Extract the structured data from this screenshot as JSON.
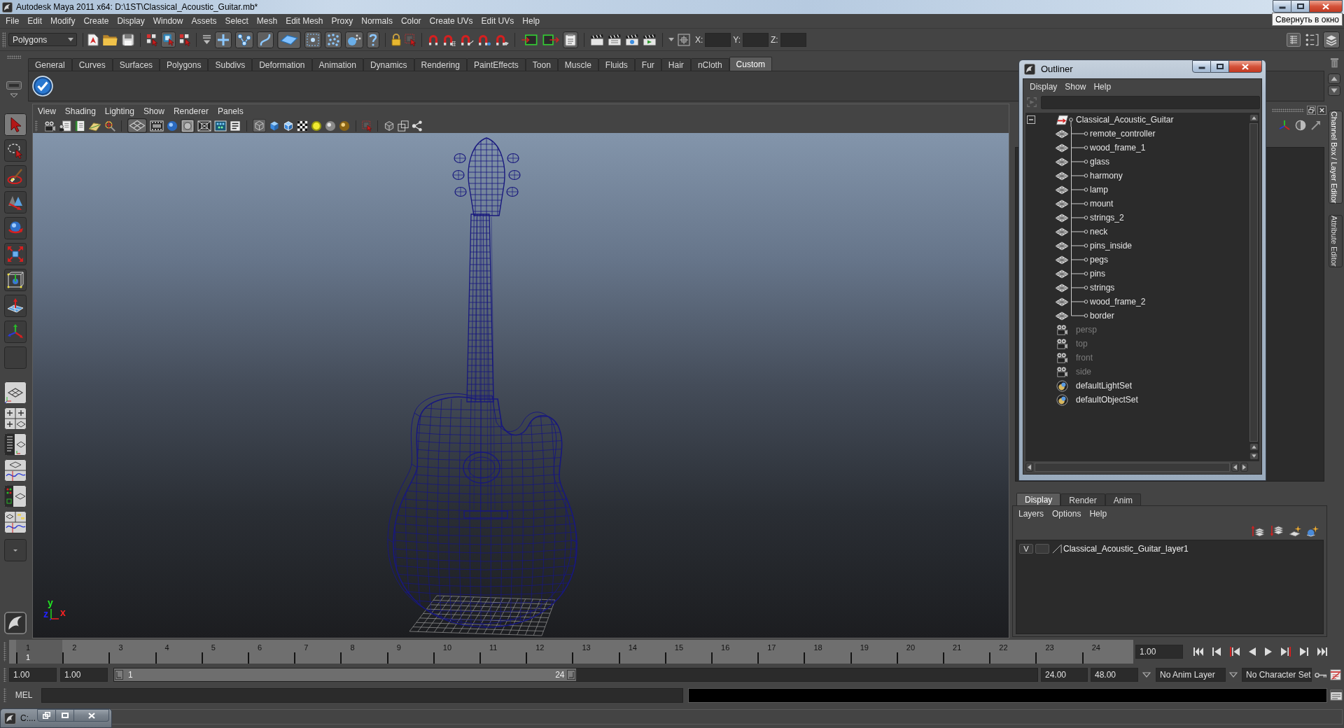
{
  "window": {
    "title": "Autodesk Maya 2011 x64: D:\\1ST\\Classical_Acoustic_Guitar.mb*",
    "tooltip": "Свернуть в окно"
  },
  "menu_bar": [
    "File",
    "Edit",
    "Modify",
    "Create",
    "Display",
    "Window",
    "Assets",
    "Select",
    "Mesh",
    "Edit Mesh",
    "Proxy",
    "Normals",
    "Color",
    "Create UVs",
    "Edit UVs",
    "Help"
  ],
  "status_line": {
    "menu_set": "Polygons",
    "buttons": [
      {
        "on": false
      },
      {
        "on": false
      },
      {
        "on": false
      },
      {
        "on": false
      },
      {
        "on": true
      },
      {
        "on": false
      },
      {
        "on": false
      },
      {
        "on": true
      },
      {
        "on": true
      },
      {
        "on": true
      },
      {
        "on": true
      },
      {
        "on": true
      },
      {
        "on": true
      },
      {
        "on": true
      },
      {
        "on": true
      },
      {
        "on": false
      },
      {
        "on": false
      },
      {
        "on": false
      },
      {
        "on": false
      },
      {
        "on": false
      },
      {
        "on": false
      },
      {
        "on": false
      },
      {
        "on": false
      },
      {
        "on": false
      },
      {
        "on": true
      },
      {
        "on": false
      },
      {
        "on": false
      },
      {
        "on": false
      },
      {
        "on": false
      },
      {
        "on": false
      },
      {
        "on": false
      },
      {
        "on": false
      },
      {
        "on": false
      },
      {
        "on": true
      }
    ],
    "fields": [
      {
        "label": "X:"
      },
      {
        "label": "Y:"
      },
      {
        "label": "Z:"
      }
    ]
  },
  "shelf": {
    "tabs": [
      {
        "label": "General",
        "selected": false
      },
      {
        "label": "Curves",
        "selected": false
      },
      {
        "label": "Surfaces",
        "selected": false
      },
      {
        "label": "Polygons",
        "selected": false
      },
      {
        "label": "Subdivs",
        "selected": false
      },
      {
        "label": "Deformation",
        "selected": false
      },
      {
        "label": "Animation",
        "selected": false
      },
      {
        "label": "Dynamics",
        "selected": false
      },
      {
        "label": "Rendering",
        "selected": false
      },
      {
        "label": "PaintEffects",
        "selected": false
      },
      {
        "label": "Toon",
        "selected": false
      },
      {
        "label": "Muscle",
        "selected": false
      },
      {
        "label": "Fluids",
        "selected": false
      },
      {
        "label": "Fur",
        "selected": false
      },
      {
        "label": "Hair",
        "selected": false
      },
      {
        "label": "nCloth",
        "selected": false
      },
      {
        "label": "Custom",
        "selected": true
      }
    ]
  },
  "toolbox": {
    "tools": [
      {
        "selected": true
      },
      {
        "selected": false
      },
      {
        "selected": false
      },
      {
        "selected": false
      },
      {
        "selected": false
      },
      {
        "selected": false
      },
      {
        "selected": false
      },
      {
        "selected": false
      },
      {
        "selected": false
      },
      {
        "selected": false
      }
    ]
  },
  "viewport": {
    "menu": [
      "View",
      "Shading",
      "Lighting",
      "Show",
      "Renderer",
      "Panels"
    ],
    "toolbar": [
      {
        "on": false
      },
      {
        "on": false
      },
      {
        "on": false
      },
      {
        "on": false
      },
      {
        "on": false
      },
      {
        "on": true
      },
      {
        "on": false
      },
      {
        "on": false
      },
      {
        "on": true
      },
      {
        "on": false
      },
      {
        "on": false
      },
      {
        "on": false
      },
      {
        "on": true
      },
      {
        "on": false
      },
      {
        "on": false
      },
      {
        "on": false
      },
      {
        "on": false
      },
      {
        "on": false
      },
      {
        "on": false
      },
      {
        "on": false
      },
      {
        "on": false
      },
      {
        "on": false
      },
      {
        "on": false
      }
    ],
    "axes": [
      {
        "label": "y",
        "color": "#22e622"
      },
      {
        "label": "z",
        "color": "#2222ff"
      },
      {
        "label": "x",
        "color": "#ff2222"
      }
    ]
  },
  "outliner": {
    "title": "Outliner",
    "menu": [
      "Display",
      "Show",
      "Help"
    ],
    "items": [
      {
        "label": "Classical_Acoustic_Guitar",
        "kind": "transform",
        "hidden": false,
        "expanded": true,
        "children": [
          {
            "label": "remote_controller",
            "kind": "mesh",
            "hidden": false
          },
          {
            "label": "wood_frame_1",
            "kind": "mesh",
            "hidden": false
          },
          {
            "label": "glass",
            "kind": "mesh",
            "hidden": false
          },
          {
            "label": "harmony",
            "kind": "mesh",
            "hidden": false
          },
          {
            "label": "lamp",
            "kind": "mesh",
            "hidden": false
          },
          {
            "label": "mount",
            "kind": "mesh",
            "hidden": false
          },
          {
            "label": "strings_2",
            "kind": "mesh",
            "hidden": false
          },
          {
            "label": "neck",
            "kind": "mesh",
            "hidden": false
          },
          {
            "label": "pins_inside",
            "kind": "mesh",
            "hidden": false
          },
          {
            "label": "pegs",
            "kind": "mesh",
            "hidden": false
          },
          {
            "label": "pins",
            "kind": "mesh",
            "hidden": false
          },
          {
            "label": "strings",
            "kind": "mesh",
            "hidden": false
          },
          {
            "label": "wood_frame_2",
            "kind": "mesh",
            "hidden": false
          },
          {
            "label": "border",
            "kind": "mesh",
            "hidden": false
          }
        ]
      },
      {
        "label": "persp",
        "kind": "camera",
        "hidden": true
      },
      {
        "label": "top",
        "kind": "camera",
        "hidden": true
      },
      {
        "label": "front",
        "kind": "camera",
        "hidden": true
      },
      {
        "label": "side",
        "kind": "camera",
        "hidden": true
      },
      {
        "label": "defaultLightSet",
        "kind": "set",
        "hidden": false
      },
      {
        "label": "defaultObjectSet",
        "kind": "set",
        "hidden": false
      }
    ]
  },
  "side_tabs": [
    {
      "label": "Channel Box / Layer Editor",
      "selected": true
    },
    {
      "label": "Attribute Editor",
      "selected": false
    }
  ],
  "layer_editor": {
    "tabs": [
      {
        "label": "Display",
        "selected": true
      },
      {
        "label": "Render",
        "selected": false
      },
      {
        "label": "Anim",
        "selected": false
      }
    ],
    "menu": [
      "Layers",
      "Options",
      "Help"
    ],
    "layers": [
      {
        "visibility": "V",
        "name": "Classical_Acoustic_Guitar_layer1"
      }
    ]
  },
  "time_slider": {
    "frames": [
      {
        "label": "1",
        "selected": true
      },
      {
        "label": "2",
        "selected": false
      },
      {
        "label": "3",
        "selected": false
      },
      {
        "label": "4",
        "selected": false
      },
      {
        "label": "5",
        "selected": false
      },
      {
        "label": "6",
        "selected": false
      },
      {
        "label": "7",
        "selected": false
      },
      {
        "label": "8",
        "selected": false
      },
      {
        "label": "9",
        "selected": false
      },
      {
        "label": "10",
        "selected": false
      },
      {
        "label": "11",
        "selected": false
      },
      {
        "label": "12",
        "selected": false
      },
      {
        "label": "13",
        "selected": false
      },
      {
        "label": "14",
        "selected": false
      },
      {
        "label": "15",
        "selected": false
      },
      {
        "label": "16",
        "selected": false
      },
      {
        "label": "17",
        "selected": false
      },
      {
        "label": "18",
        "selected": false
      },
      {
        "label": "19",
        "selected": false
      },
      {
        "label": "20",
        "selected": false
      },
      {
        "label": "21",
        "selected": false
      },
      {
        "label": "22",
        "selected": false
      },
      {
        "label": "23",
        "selected": false
      },
      {
        "label": "24",
        "selected": false
      }
    ],
    "current_frame": "1",
    "current_time": "1.00"
  },
  "range_slider": {
    "start_time": "1.00",
    "playback_start": "1.00",
    "range_start": "1",
    "range_end": "24",
    "level": 0.5,
    "playback_end": "24.00",
    "end_time": "48.00",
    "anim_layer": "No Anim Layer",
    "character_set": "No Character Set"
  },
  "command_line": {
    "language": "MEL"
  },
  "minimized_window": {
    "title": "C:..."
  }
}
